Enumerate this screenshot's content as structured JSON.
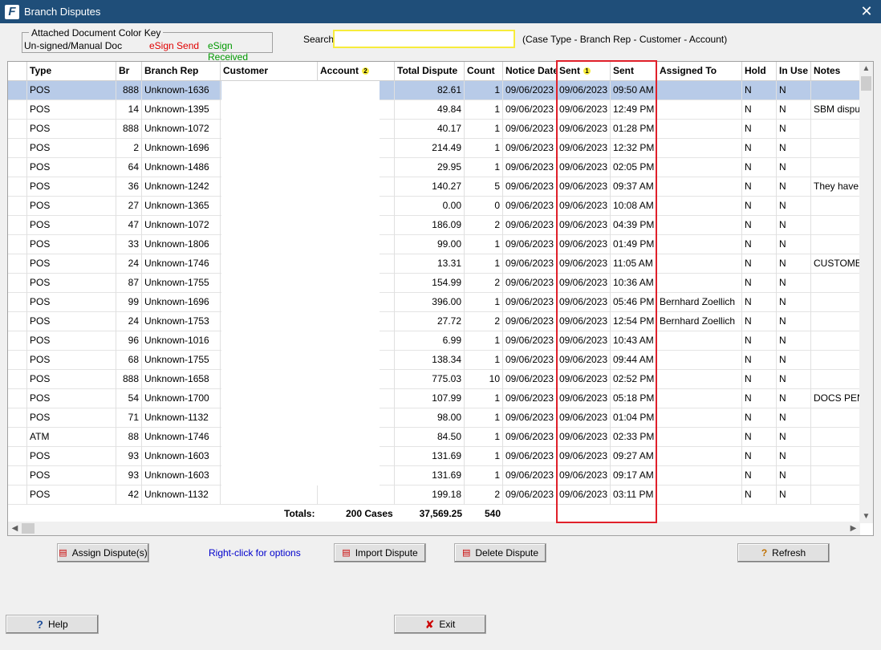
{
  "window": {
    "title": "Branch Disputes",
    "app_icon": "F"
  },
  "color_key": {
    "legend": "Attached Document Color Key",
    "unsigned": "Un-signed/Manual  Doc",
    "esign_send": "eSign Send",
    "esign_received": "eSign Received",
    "colors": {
      "unsigned": "#000000",
      "esign_send": "#e00000",
      "esign_received": "#009900"
    }
  },
  "search": {
    "label": "Search",
    "value": "",
    "hint": "(Case Type - Branch Rep - Customer - Account)"
  },
  "grid": {
    "headers": {
      "type": "Type",
      "br": "Br",
      "branch_rep": "Branch Rep",
      "customer": "Customer",
      "account": "Account",
      "account_sort": "2",
      "total": "Total Dispute",
      "count": "Count",
      "notice": "Notice Date",
      "sent1": "Sent",
      "sent1_sort": "1",
      "sent2": "Sent",
      "assigned": "Assigned To",
      "hold": "Hold",
      "inuse": "In Use",
      "notes": "Notes"
    },
    "rows": [
      {
        "type": "POS",
        "br": "888",
        "rep": "Unknown-1636",
        "total": "82.61",
        "count": "1",
        "notice": "09/06/2023",
        "sent_date": "09/06/2023",
        "sent_time": "09:50 AM",
        "assigned": "",
        "hold": "N",
        "inuse": "N",
        "notes": ""
      },
      {
        "type": "POS",
        "br": "14",
        "rep": "Unknown-1395",
        "total": "49.84",
        "count": "1",
        "notice": "09/06/2023",
        "sent_date": "09/06/2023",
        "sent_time": "12:49 PM",
        "assigned": "",
        "hold": "N",
        "inuse": "N",
        "notes": "SBM dispute"
      },
      {
        "type": "POS",
        "br": "888",
        "rep": "Unknown-1072",
        "total": "40.17",
        "count": "1",
        "notice": "09/06/2023",
        "sent_date": "09/06/2023",
        "sent_time": "01:28 PM",
        "assigned": "",
        "hold": "N",
        "inuse": "N",
        "notes": ""
      },
      {
        "type": "POS",
        "br": "2",
        "rep": "Unknown-1696",
        "total": "214.49",
        "count": "1",
        "notice": "09/06/2023",
        "sent_date": "09/06/2023",
        "sent_time": "12:32 PM",
        "assigned": "",
        "hold": "N",
        "inuse": "N",
        "notes": ""
      },
      {
        "type": "POS",
        "br": "64",
        "rep": "Unknown-1486",
        "total": "29.95",
        "count": "1",
        "notice": "09/06/2023",
        "sent_date": "09/06/2023",
        "sent_time": "02:05 PM",
        "assigned": "",
        "hold": "N",
        "inuse": "N",
        "notes": ""
      },
      {
        "type": "POS",
        "br": "36",
        "rep": "Unknown-1242",
        "total": "140.27",
        "count": "5",
        "notice": "09/06/2023",
        "sent_date": "09/06/2023",
        "sent_time": "09:37 AM",
        "assigned": "",
        "hold": "N",
        "inuse": "N",
        "notes": "They have b"
      },
      {
        "type": "POS",
        "br": "27",
        "rep": "Unknown-1365",
        "total": "0.00",
        "count": "0",
        "notice": "09/06/2023",
        "sent_date": "09/06/2023",
        "sent_time": "10:08 AM",
        "assigned": "",
        "hold": "N",
        "inuse": "N",
        "notes": ""
      },
      {
        "type": "POS",
        "br": "47",
        "rep": "Unknown-1072",
        "total": "186.09",
        "count": "2",
        "notice": "09/06/2023",
        "sent_date": "09/06/2023",
        "sent_time": "04:39 PM",
        "assigned": "",
        "hold": "N",
        "inuse": "N",
        "notes": ""
      },
      {
        "type": "POS",
        "br": "33",
        "rep": "Unknown-1806",
        "total": "99.00",
        "count": "1",
        "notice": "09/06/2023",
        "sent_date": "09/06/2023",
        "sent_time": "01:49 PM",
        "assigned": "",
        "hold": "N",
        "inuse": "N",
        "notes": ""
      },
      {
        "type": "POS",
        "br": "24",
        "rep": "Unknown-1746",
        "total": "13.31",
        "count": "1",
        "notice": "09/06/2023",
        "sent_date": "09/06/2023",
        "sent_time": "11:05 AM",
        "assigned": "",
        "hold": "N",
        "inuse": "N",
        "notes": "CUSTOMER"
      },
      {
        "type": "POS",
        "br": "87",
        "rep": "Unknown-1755",
        "total": "154.99",
        "count": "2",
        "notice": "09/06/2023",
        "sent_date": "09/06/2023",
        "sent_time": "10:36 AM",
        "assigned": "",
        "hold": "N",
        "inuse": "N",
        "notes": ""
      },
      {
        "type": "POS",
        "br": "99",
        "rep": "Unknown-1696",
        "total": "396.00",
        "count": "1",
        "notice": "09/06/2023",
        "sent_date": "09/06/2023",
        "sent_time": "05:46 PM",
        "assigned": "Bernhard Zoellich",
        "hold": "N",
        "inuse": "N",
        "notes": ""
      },
      {
        "type": "POS",
        "br": "24",
        "rep": "Unknown-1753",
        "total": "27.72",
        "count": "2",
        "notice": "09/06/2023",
        "sent_date": "09/06/2023",
        "sent_time": "12:54 PM",
        "assigned": "Bernhard Zoellich",
        "hold": "N",
        "inuse": "N",
        "notes": ""
      },
      {
        "type": "POS",
        "br": "96",
        "rep": "Unknown-1016",
        "total": "6.99",
        "count": "1",
        "notice": "09/06/2023",
        "sent_date": "09/06/2023",
        "sent_time": "10:43 AM",
        "assigned": "",
        "hold": "N",
        "inuse": "N",
        "notes": ""
      },
      {
        "type": "POS",
        "br": "68",
        "rep": "Unknown-1755",
        "total": "138.34",
        "count": "1",
        "notice": "09/06/2023",
        "sent_date": "09/06/2023",
        "sent_time": "09:44 AM",
        "assigned": "",
        "hold": "N",
        "inuse": "N",
        "notes": ""
      },
      {
        "type": "POS",
        "br": "888",
        "rep": "Unknown-1658",
        "total": "775.03",
        "count": "10",
        "notice": "09/06/2023",
        "sent_date": "09/06/2023",
        "sent_time": "02:52 PM",
        "assigned": "",
        "hold": "N",
        "inuse": "N",
        "notes": ""
      },
      {
        "type": "POS",
        "br": "54",
        "rep": "Unknown-1700",
        "total": "107.99",
        "count": "1",
        "notice": "09/06/2023",
        "sent_date": "09/06/2023",
        "sent_time": "05:18 PM",
        "assigned": "",
        "hold": "N",
        "inuse": "N",
        "notes": "DOCS PEND"
      },
      {
        "type": "POS",
        "br": "71",
        "rep": "Unknown-1132",
        "total": "98.00",
        "count": "1",
        "notice": "09/06/2023",
        "sent_date": "09/06/2023",
        "sent_time": "01:04 PM",
        "assigned": "",
        "hold": "N",
        "inuse": "N",
        "notes": ""
      },
      {
        "type": "ATM",
        "br": "88",
        "rep": "Unknown-1746",
        "total": "84.50",
        "count": "1",
        "notice": "09/06/2023",
        "sent_date": "09/06/2023",
        "sent_time": "02:33 PM",
        "assigned": "",
        "hold": "N",
        "inuse": "N",
        "notes": ""
      },
      {
        "type": "POS",
        "br": "93",
        "rep": "Unknown-1603",
        "total": "131.69",
        "count": "1",
        "notice": "09/06/2023",
        "sent_date": "09/06/2023",
        "sent_time": "09:27 AM",
        "assigned": "",
        "hold": "N",
        "inuse": "N",
        "notes": ""
      },
      {
        "type": "POS",
        "br": "93",
        "rep": "Unknown-1603",
        "total": "131.69",
        "count": "1",
        "notice": "09/06/2023",
        "sent_date": "09/06/2023",
        "sent_time": "09:17 AM",
        "assigned": "",
        "hold": "N",
        "inuse": "N",
        "notes": ""
      },
      {
        "type": "POS",
        "br": "42",
        "rep": "Unknown-1132",
        "total": "199.18",
        "count": "2",
        "notice": "09/06/2023",
        "sent_date": "09/06/2023",
        "sent_time": "03:11 PM",
        "assigned": "",
        "hold": "N",
        "inuse": "N",
        "notes": ""
      }
    ],
    "totals": {
      "label": "Totals:",
      "cases": "200 Cases",
      "total": "37,569.25",
      "count": "540"
    },
    "selected_row_color": "#b8cbe8",
    "highlight_color": "#e0202a"
  },
  "buttons": {
    "assign": "Assign Dispute(s)",
    "right_click": "Right-click for options",
    "import": "Import Dispute",
    "delete": "Delete Dispute",
    "refresh": "Refresh",
    "help": "Help",
    "exit": "Exit"
  }
}
